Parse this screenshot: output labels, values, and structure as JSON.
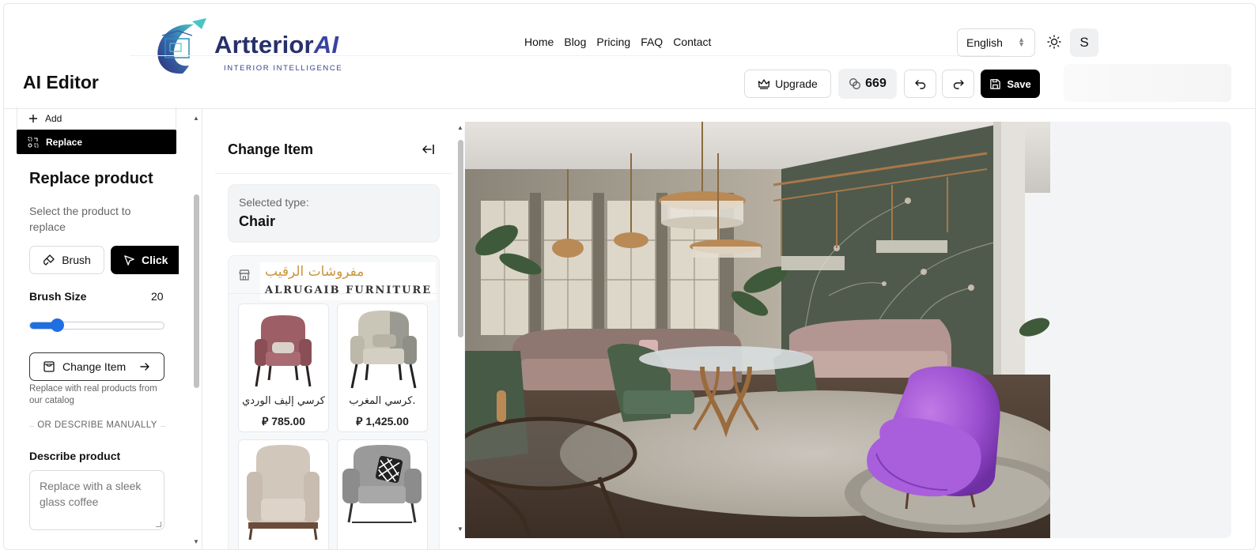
{
  "brand": {
    "name": "Artterior",
    "name_ai": "AI",
    "tagline": "INTERIOR INTELLIGENCE"
  },
  "nav": {
    "items": [
      "Home",
      "Blog",
      "Pricing",
      "FAQ",
      "Contact"
    ]
  },
  "header": {
    "language": "English",
    "user_initial": "S"
  },
  "editor": {
    "title": "AI Editor",
    "upgrade_label": "Upgrade",
    "credits": "669",
    "save_label": "Save"
  },
  "tools": {
    "add_label": "Add",
    "replace_label": "Replace"
  },
  "replace_panel": {
    "title": "Replace product",
    "description": "Select the product to replace",
    "brush_label": "Brush",
    "click_label": "Click",
    "brush_size_label": "Brush Size",
    "brush_size_value": "20",
    "brush_size_fraction": 0.2,
    "change_item_label": "Change Item",
    "change_item_note": "Replace with real products from our catalog",
    "or_text": "OR DESCRIBE MANUALLY",
    "describe_label": "Describe product",
    "describe_placeholder": "Replace with a sleek glass coffee"
  },
  "change_item": {
    "title": "Change Item",
    "selected_type_label": "Selected type:",
    "selected_type_value": "Chair",
    "store": {
      "name_ar": "مفروشات الرقيب",
      "name_en": "ALRUGAIB FURNITURE"
    },
    "products": [
      {
        "name": "كرسي إليف الوردي",
        "price": "785.00",
        "color": "#a76a70"
      },
      {
        "name": "كرسي المغرب.",
        "price": "1,425.00",
        "color": "#c9c6b8"
      },
      {
        "name": "",
        "price": "",
        "color": "#cbbfb2"
      },
      {
        "name": "",
        "price": "",
        "color": "#9a9a9a"
      }
    ]
  },
  "colors": {
    "accent": "#1e6fe0",
    "primary": "#000000",
    "chair_highlight": "#9b4fd0"
  }
}
